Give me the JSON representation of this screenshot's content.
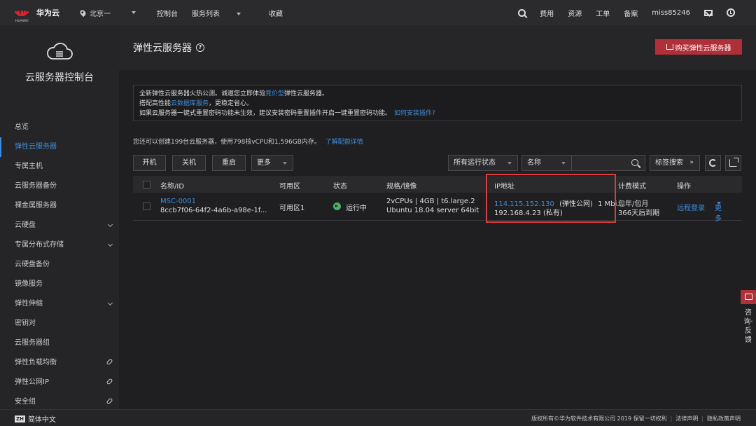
{
  "topbar": {
    "logo_text": "HUAWEI",
    "brand": "华为云",
    "region": "北京一",
    "nav": [
      "控制台",
      "服务列表",
      "收藏"
    ],
    "right": [
      "费用",
      "资源",
      "工单",
      "备案"
    ],
    "user": "miss85246"
  },
  "sidebar": {
    "title": "云服务器控制台",
    "items": [
      {
        "label": "总览"
      },
      {
        "label": "弹性云服务器"
      },
      {
        "label": "专属主机"
      },
      {
        "label": "云服务器备份"
      },
      {
        "label": "裸金属服务器"
      },
      {
        "label": "云硬盘"
      },
      {
        "label": "专属分布式存储"
      },
      {
        "label": "云硬盘备份"
      },
      {
        "label": "镜像服务"
      },
      {
        "label": "弹性伸缩"
      },
      {
        "label": "密钥对"
      },
      {
        "label": "云服务器组"
      },
      {
        "label": "弹性负载均衡"
      },
      {
        "label": "弹性公网IP"
      },
      {
        "label": "安全组"
      }
    ]
  },
  "page": {
    "title": "弹性云服务器",
    "buy_button": "购买弹性云服务器"
  },
  "notice": {
    "line1_pre": "全新弹性云服务器火热公测。诚邀您立即体验",
    "line1_link": "竞价型",
    "line1_post": "弹性云服务器。",
    "line2_pre": "搭配高性能",
    "line2_link": "云数据库服务",
    "line2_post": "，更稳定省心。",
    "line3_pre": "如果云服务器一键式重置密码功能未生效，建议安装密码重置插件开启一键重置密码功能。",
    "line3_link": "如何安装插件?"
  },
  "quota": {
    "text": "您还可以创建199台云服务器，使用798核vCPU和1,596GB内存。",
    "link": "了解配额详情"
  },
  "toolbar": {
    "start": "开机",
    "stop": "关机",
    "restart": "重启",
    "more": "更多",
    "status_filter": "所有运行状态",
    "field_select": "名称",
    "tag_search": "标签搜索"
  },
  "table": {
    "headers": [
      "名称/ID",
      "可用区",
      "状态",
      "规格/镜像",
      "IP地址",
      "计费模式",
      "操作"
    ],
    "rows": [
      {
        "name": "MSC-0001",
        "id": "8ccb7f06-64f2-4a6b-a98e-1f...",
        "zone": "可用区1",
        "status": "运行中",
        "spec": "2vCPUs | 4GB | t6.large.2",
        "image": "Ubuntu 18.04 server 64bit",
        "ip_public": "114.115.152.130",
        "ip_public_label": "(弹性公网)",
        "ip_bandwidth": "1 Mbi...",
        "ip_private": "192.168.4.23 (私有)",
        "billing": "包年/包月",
        "expire": "366天后到期",
        "op_login": "远程登录",
        "op_more": "更多"
      }
    ]
  },
  "float": {
    "text": "咨询·反馈"
  },
  "footer": {
    "lang": "简体中文",
    "lang_badge": "ZH",
    "copyright": "版权所有©华为软件技术有限公司 2019 保留一切权利",
    "legal": "法律声明",
    "privacy": "隐私政策声明"
  }
}
